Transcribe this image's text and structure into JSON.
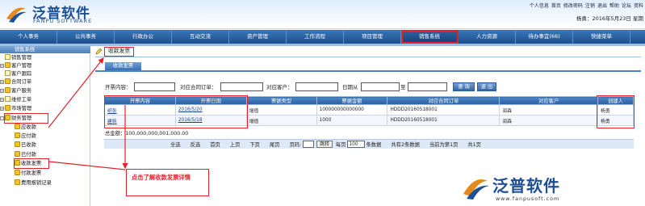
{
  "header": {
    "logo_text": "泛普软件",
    "logo_sub": "FANPU SOFTWARE",
    "top_links": [
      "个人信息",
      "首页",
      "修改密码",
      "注销",
      "退出",
      "帮助",
      "论坛",
      "资料"
    ],
    "user_line": "杨勇：2016年5月23日 星期"
  },
  "nav": {
    "items": [
      "个人事务",
      "公共事务",
      "行政办公",
      "互动交流",
      "资产管理",
      "工作流程",
      "项目管理",
      "销售系统",
      "人力资源",
      "待办事宜(66)",
      "快捷菜单"
    ],
    "active": "销售系统"
  },
  "sidebar": {
    "root": "销售系统",
    "items": [
      "销售管理",
      "客户管理",
      "客户跟踪",
      "合同订单",
      "客户服务",
      "维修工单",
      "市场管理",
      "财务管理",
      "应收款",
      "应付款",
      "已收款",
      "已付款",
      "收款发票",
      "付款发票",
      "费用报销记录"
    ]
  },
  "main": {
    "tab_title": "收款发票",
    "subtab": "收款发票",
    "search": {
      "label_content": "开票内容：",
      "label_order": "对应合同订单：",
      "label_customer": "对应客户：",
      "label_date_from": "日期从",
      "label_date_to": "至",
      "btn_query": "查 询",
      "btn_back": "退 出"
    },
    "table": {
      "headers": [
        "开票内容",
        "开票日期",
        "票据类型",
        "票据金额",
        "对应合同订单",
        "对应客户",
        "创建人"
      ],
      "rows": [
        [
          "纸张",
          "2016/5/20",
          "增值",
          "100000000000000",
          "HDDD20160518001",
          "润森",
          "杨勇"
        ],
        [
          "建筑",
          "2016/5/18",
          "增值",
          "1000",
          "HDDD20160518001",
          "润森",
          "杨勇"
        ]
      ]
    },
    "total": "总金额：100,000,000,001,000.00",
    "pager": {
      "select_all": "全选",
      "invert": "反选",
      "first": "首页",
      "prev": "上页",
      "next": "下页",
      "last": "尾页",
      "page_code": "页码:",
      "jump": "跳转",
      "per_page_prefix": "每页",
      "per_page_value": "100",
      "per_page_suffix": "条数据",
      "total_count": "共有2条数据",
      "current": "当前为第1页",
      "total_pages": "共1页"
    },
    "callout": "点击了解收款发票详情"
  },
  "brand": {
    "text": "泛普软件",
    "url": "www.fanpusoft.com"
  },
  "colors": {
    "accent_red": "#e0242b",
    "nav_blue": "#1d4f8d",
    "brand_blue": "#1c4f96"
  }
}
